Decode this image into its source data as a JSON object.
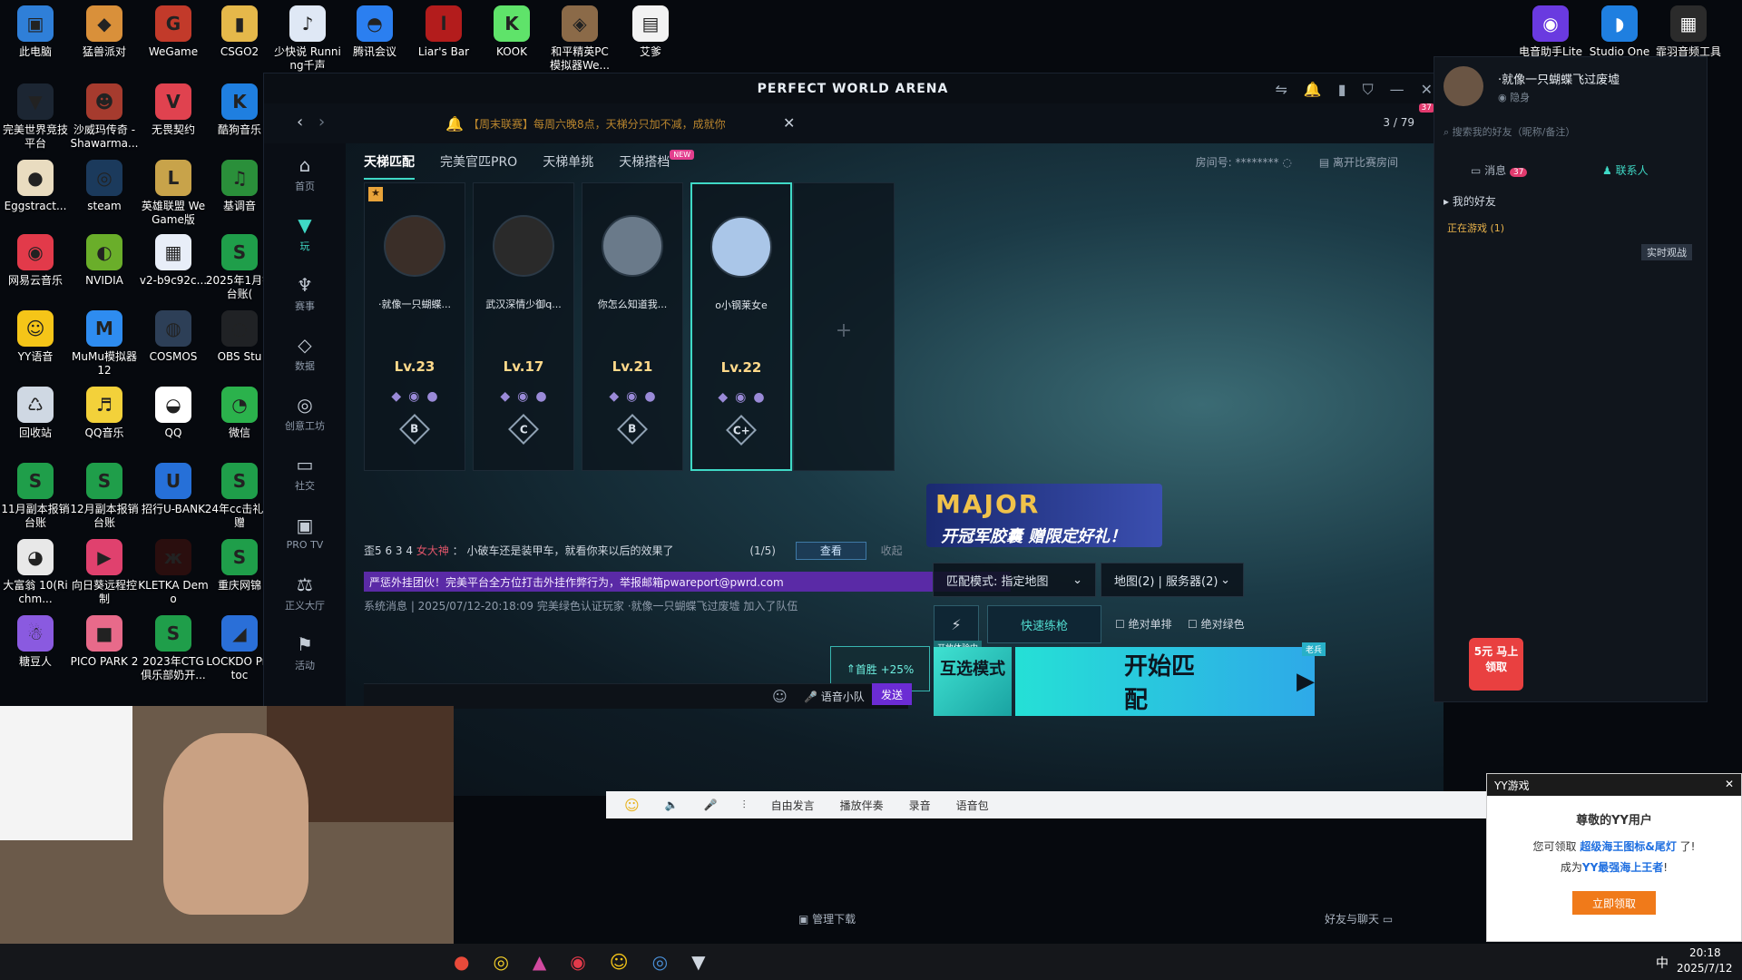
{
  "desktop": {
    "icons": [
      {
        "label": "此电脑",
        "color": "#2f7fd8",
        "glyph": "▣"
      },
      {
        "label": "猛兽派对",
        "color": "#d9903a",
        "glyph": "◆"
      },
      {
        "label": "WeGame",
        "color": "#c23a2a",
        "glyph": "G"
      },
      {
        "label": "CSGO2",
        "color": "#e5b84a",
        "glyph": "▮"
      },
      {
        "label": "少快说 Running千声",
        "color": "#dfe8f5",
        "glyph": "♪"
      },
      {
        "label": "腾讯会议",
        "color": "#2b7ff0",
        "glyph": "◓"
      },
      {
        "label": "Liar's Bar",
        "color": "#b31c1c",
        "glyph": "l"
      },
      {
        "label": "KOOK",
        "color": "#5fe36a",
        "glyph": "K"
      },
      {
        "label": "和平精英PC 模拟器We...",
        "color": "#8b6a48",
        "glyph": "◈"
      },
      {
        "label": "艾爹",
        "color": "#f2f2f2",
        "glyph": "▤"
      },
      {
        "label": "完美世界竞技平台",
        "color": "#1c2633",
        "glyph": "▼"
      },
      {
        "label": "沙威玛传奇 - Shawarma...",
        "color": "#a63b2e",
        "glyph": "☻"
      },
      {
        "label": "无畏契约",
        "color": "#e0424f",
        "glyph": "V"
      },
      {
        "label": "酷狗音乐",
        "color": "#1f7fe0",
        "glyph": "K"
      },
      {
        "label": "Eggstract...",
        "color": "#e9dcc0",
        "glyph": "●"
      },
      {
        "label": "steam",
        "color": "#1b3a5c",
        "glyph": "◎"
      },
      {
        "label": "英雄联盟 WeGame版",
        "color": "#c8a34a",
        "glyph": "L"
      },
      {
        "label": "基调音",
        "color": "#2a8f3a",
        "glyph": "♫"
      },
      {
        "label": "网易云音乐",
        "color": "#e23a4a",
        "glyph": "◉"
      },
      {
        "label": "NVIDIA",
        "color": "#6aae2a",
        "glyph": "◐"
      },
      {
        "label": "v2-b9c92c...",
        "color": "#e8eef8",
        "glyph": "▦"
      },
      {
        "label": "2025年1月销台账(",
        "color": "#1f9e4a",
        "glyph": "S"
      },
      {
        "label": "YY语音",
        "color": "#f5c518",
        "glyph": "☺"
      },
      {
        "label": "MuMu模拟器12",
        "color": "#2e8cf0",
        "glyph": "M"
      },
      {
        "label": "COSMOS",
        "color": "#2d3f57",
        "glyph": "◍"
      },
      {
        "label": "OBS Stu",
        "color": "#202225",
        "glyph": "◌"
      },
      {
        "label": "回收站",
        "color": "#cfd8e3",
        "glyph": "♺"
      },
      {
        "label": "QQ音乐",
        "color": "#f3d13a",
        "glyph": "♬"
      },
      {
        "label": "QQ",
        "color": "#ffffff",
        "glyph": "◒"
      },
      {
        "label": "微信",
        "color": "#2bb24c",
        "glyph": "◔"
      },
      {
        "label": "11月副本报销台账",
        "color": "#1f9e4a",
        "glyph": "S"
      },
      {
        "label": "12月副本报销台账",
        "color": "#1f9e4a",
        "glyph": "S"
      },
      {
        "label": "招行U-BANK",
        "color": "#2670d8",
        "glyph": "U"
      },
      {
        "label": "24年cc击礼物赠",
        "color": "#1f9e4a",
        "glyph": "S"
      },
      {
        "label": "大富翁 10(Richm...",
        "color": "#e8e8e8",
        "glyph": "◕"
      },
      {
        "label": "向日葵远程控制",
        "color": "#e0416e",
        "glyph": "▶"
      },
      {
        "label": "KLETKA Demo",
        "color": "#2a0e0e",
        "glyph": "ж"
      },
      {
        "label": "重庆网锦",
        "color": "#1f9e4a",
        "glyph": "S"
      },
      {
        "label": "糖豆人",
        "color": "#8a5ae0",
        "glyph": "☃"
      },
      {
        "label": "PICO PARK 2",
        "color": "#e86a8a",
        "glyph": "■"
      },
      {
        "label": "2023年CTG俱乐部奶开...",
        "color": "#1f9e4a",
        "glyph": "S"
      },
      {
        "label": "LOCKDO Protoc",
        "color": "#2a6fd8",
        "glyph": "◢"
      }
    ],
    "right_icons": [
      {
        "label": "电音助手Lite",
        "color": "#6a3ae0",
        "glyph": "◉"
      },
      {
        "label": "Studio One",
        "color": "#1f7fe0",
        "glyph": "◗"
      },
      {
        "label": "霏羽音频工具",
        "color": "#2b2b2b",
        "glyph": "▦"
      }
    ]
  },
  "window": {
    "title": "PERFECT WORLD ARENA",
    "notice": "【周末联赛】每周六晚8点，天梯分只加不减，成就你",
    "online": "3 / 79",
    "badge_count": "37"
  },
  "sidebar": [
    {
      "label": "首页",
      "icon": "home-icon",
      "glyph": "⌂"
    },
    {
      "label": "玩",
      "icon": "play-icon",
      "glyph": "▼",
      "active": true
    },
    {
      "label": "赛事",
      "icon": "trophy-icon",
      "glyph": "♆"
    },
    {
      "label": "数据",
      "icon": "data-icon",
      "glyph": "◇"
    },
    {
      "label": "创意工坊",
      "icon": "workshop-icon",
      "glyph": "◎"
    },
    {
      "label": "社交",
      "icon": "social-icon",
      "glyph": "▭"
    },
    {
      "label": "PRO TV",
      "icon": "tv-icon",
      "glyph": "▣"
    },
    {
      "label": "正义大厅",
      "icon": "justice-icon",
      "glyph": "⚖"
    },
    {
      "label": "活动",
      "icon": "gift-icon",
      "glyph": "⚑"
    }
  ],
  "tabs": [
    {
      "label": "天梯匹配",
      "active": true
    },
    {
      "label": "完美官匹PRO"
    },
    {
      "label": "天梯单挑"
    },
    {
      "label": "天梯搭档",
      "badge": "NEW"
    }
  ],
  "room": {
    "label": "房间号:",
    "value": "********",
    "leave": "离开比赛房间"
  },
  "players": [
    {
      "name": "·就像一只蝴蝶...",
      "level": "Lv.23",
      "rank": "B",
      "avatar_color": "#3a2e28"
    },
    {
      "name": "武汉深情少御q...",
      "level": "Lv.17",
      "rank": "C",
      "avatar_color": "#2a2a2a"
    },
    {
      "name": "你怎么知道我...",
      "level": "Lv.21",
      "rank": "B",
      "avatar_color": "#6a7a8a"
    },
    {
      "name": "o小钢莱女e",
      "level": "Lv.22",
      "rank": "C+",
      "avatar_color": "#aac6e8"
    }
  ],
  "chat": {
    "line1_prefix": "歪5 6 3 4",
    "line1_user": "女大神",
    "line1_text": "：  小破车还是装甲车，就看你来以后的效果了",
    "line1_count": "(1/5)",
    "view_btn": "查看",
    "collapse": "收起",
    "warning": "严惩外挂团伙！完美平台全方位打击外挂作弊行为，举报邮箱pwareport@pwrd.com",
    "system": "系统消息 | 2025/07/12-20:18:09 完美绿色认证玩家 ·就像一只蝴蝶飞过废墟 加入了队伍",
    "send": "发送",
    "voice": "语音小队"
  },
  "ad": {
    "big": "MAJOR",
    "text": "开冠军胶囊 赠限定好礼！"
  },
  "match": {
    "mode_label": "匹配模式:",
    "mode_value": "指定地图",
    "map_server": "地图(2) | 服务器(2)",
    "quick": "快速练枪",
    "opt1": "绝对单排",
    "opt2": "绝对绿色",
    "bonus": "首胜 +25%",
    "trial": "开放体验中",
    "mode_btn": "互选模式",
    "start": "开始匹配",
    "veteran": "老兵"
  },
  "friends": {
    "username": "·就像一只蝴蝶飞过废墟",
    "status": "隐身",
    "search_placeholder": "搜索我的好友（昵称/备注）",
    "tab_msg": "消息",
    "msg_count": "37",
    "tab_contacts": "联系人",
    "group": "我的好友",
    "playing": "正在游戏 (1)",
    "watch": "实时观战",
    "promo": "5元 马上领取"
  },
  "yybar": {
    "items": [
      "自由发言",
      "播放伴奏",
      "录音",
      "语音包"
    ],
    "manage": "管理下载",
    "chat": "好友与聊天"
  },
  "yypop": {
    "title": "YY游戏",
    "greet": "尊敬的YY用户",
    "line1a": "您可领取",
    "line1b": "超级海王图标&尾灯",
    "line1c": "了!",
    "line2a": "成为",
    "line2b": "YY最强海上王者",
    "line2c": "!",
    "btn": "立即领取"
  },
  "taskbar": {
    "time": "20:18",
    "date": "2025/7/12",
    "ime": "中"
  }
}
